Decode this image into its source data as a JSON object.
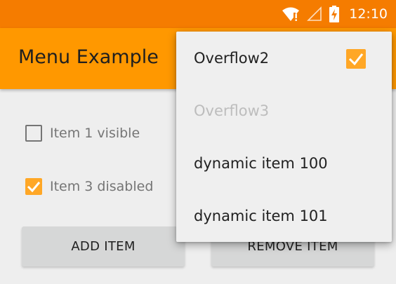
{
  "status_bar": {
    "time": "12:10",
    "icons": [
      "wifi-icon",
      "signal-icon",
      "battery-charging-icon"
    ],
    "color": "#f57c00"
  },
  "app_bar": {
    "title": "Menu Example",
    "color": "#ff9800"
  },
  "checkboxes": [
    {
      "label": "Item 1 visible",
      "checked": false
    },
    {
      "label": "Item 3 disabled",
      "checked": true
    }
  ],
  "buttons": {
    "add": "ADD ITEM",
    "remove": "REMOVE ITEM"
  },
  "overflow_menu": {
    "items": [
      {
        "label": "Overflow2",
        "checked": true,
        "enabled": true
      },
      {
        "label": "Overflow3",
        "enabled": false
      },
      {
        "label": "dynamic item 100",
        "enabled": true
      },
      {
        "label": "dynamic item 101",
        "enabled": true
      }
    ]
  },
  "accent_color": "#ffa726"
}
